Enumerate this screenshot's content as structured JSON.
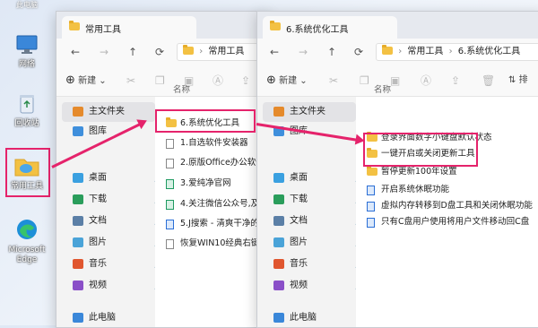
{
  "desktop": {
    "top_label": "此电脑",
    "icons": [
      {
        "label": "网络"
      },
      {
        "label": "回收站"
      },
      {
        "label": "常用工具"
      },
      {
        "label": "Microsoft Edge"
      }
    ]
  },
  "window1": {
    "tab_title": "常用工具",
    "address": "常用工具",
    "new_label": "新建",
    "sidebar": [
      {
        "label": "主文件夹"
      },
      {
        "label": "图库"
      },
      {
        "label": "桌面"
      },
      {
        "label": "下载"
      },
      {
        "label": "文档"
      },
      {
        "label": "图片"
      },
      {
        "label": "音乐"
      },
      {
        "label": "视频"
      },
      {
        "label": "此电脑"
      }
    ],
    "column_name": "名称",
    "files": [
      {
        "name": "6.系统优化工具"
      },
      {
        "name": "1.自选软件安装器"
      },
      {
        "name": "2.原版Office办公软件分"
      },
      {
        "name": "3.爱纯净官网"
      },
      {
        "name": "4.关注微信公众号,及时了"
      },
      {
        "name": "5.J搜索 - 清爽干净的上网"
      },
      {
        "name": "恢复WIN10经典右键"
      }
    ]
  },
  "window2": {
    "tab_title": "6.系统优化工具",
    "address_parent": "常用工具",
    "address_current": "6.系统优化工具",
    "new_label": "新建",
    "sort_label": "排",
    "sidebar": [
      {
        "label": "主文件夹"
      },
      {
        "label": "图库"
      },
      {
        "label": "桌面"
      },
      {
        "label": "下载"
      },
      {
        "label": "文档"
      },
      {
        "label": "图片"
      },
      {
        "label": "音乐"
      },
      {
        "label": "视频"
      },
      {
        "label": "此电脑"
      }
    ],
    "column_name": "名称",
    "files": [
      {
        "name": "登录界面数字小键盘默认状态"
      },
      {
        "name": "一键开启或关闭更新工具"
      },
      {
        "name": "暂停更新100年设置"
      },
      {
        "name": "开启系统休眠功能"
      },
      {
        "name": "虚拟内存转移到D盘工具和关闭休眠功能"
      },
      {
        "name": "只有C盘用户使用将用户文件移动回C盘"
      }
    ]
  }
}
